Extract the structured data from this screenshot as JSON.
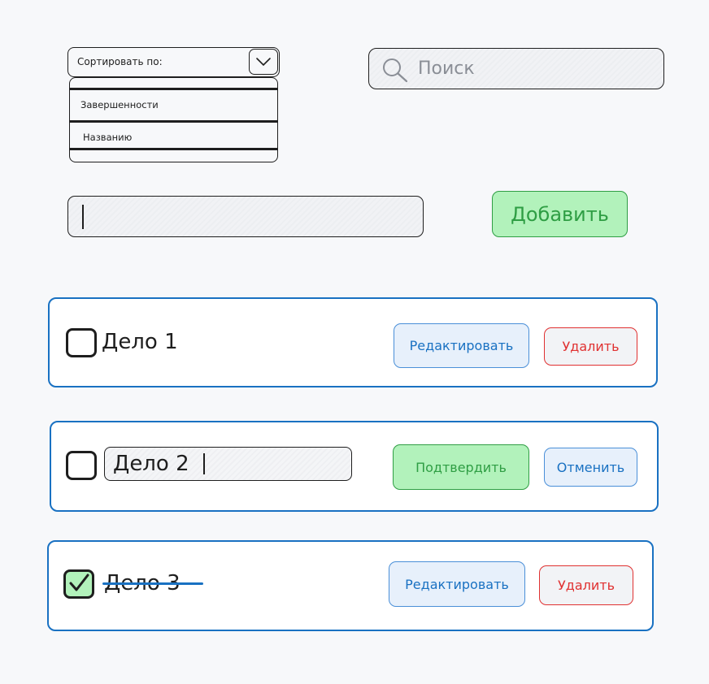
{
  "sort": {
    "label": "Сортировать по:",
    "options": [
      "Завершенности",
      "Названию"
    ]
  },
  "search": {
    "placeholder": "Поиск"
  },
  "new_task": {
    "value": ""
  },
  "add_button": {
    "label": "Добавить"
  },
  "tasks": [
    {
      "title": "Дело 1",
      "checked": false,
      "editing": false,
      "done": false,
      "primary_action": "Редактировать",
      "secondary_action": "Удалить"
    },
    {
      "title": "Дело 2",
      "checked": false,
      "editing": true,
      "done": false,
      "primary_action": "Подтвердить",
      "secondary_action": "Отменить"
    },
    {
      "title": "Дело 3",
      "checked": true,
      "editing": false,
      "done": true,
      "primary_action": "Редактировать",
      "secondary_action": "Удалить"
    }
  ],
  "colors": {
    "card_border": "#1971c2",
    "add_fill": "#b2f2bb",
    "add_text": "#2f9e44",
    "delete_text": "#e03131",
    "edit_text": "#1971c2",
    "strike": "#1971c2"
  }
}
